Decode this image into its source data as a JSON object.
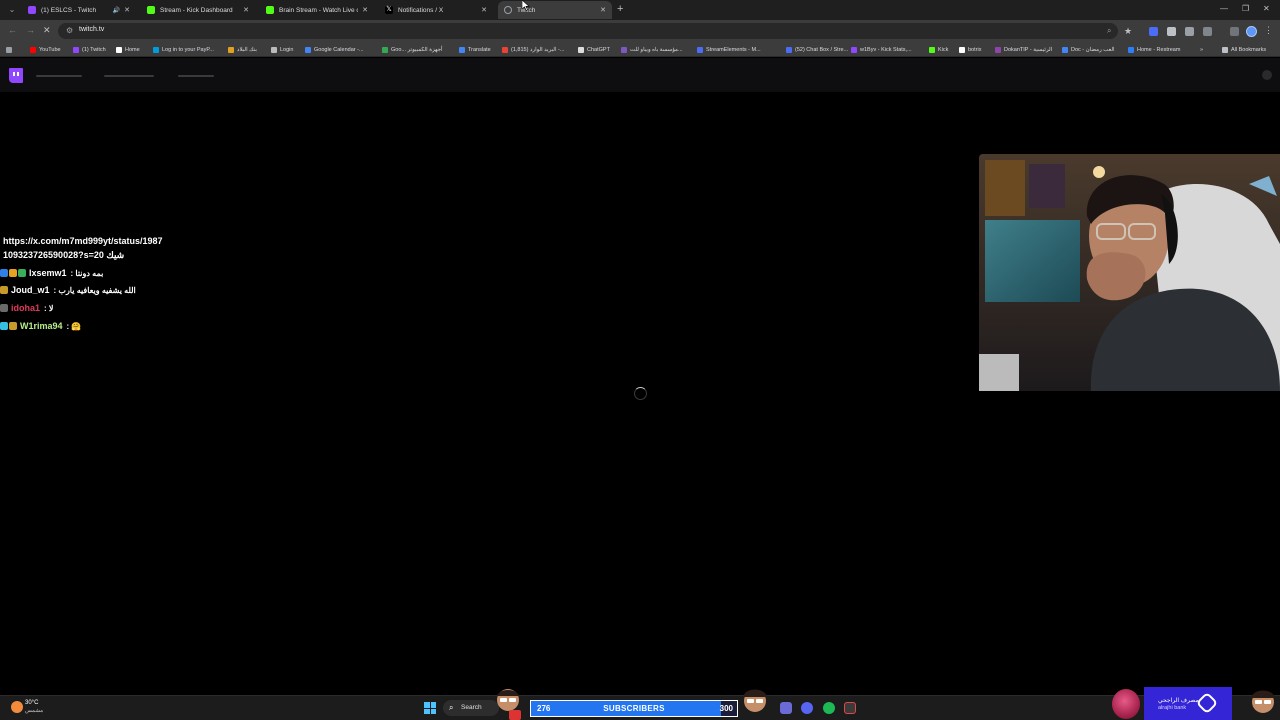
{
  "browser": {
    "tabs": [
      {
        "title": "(1) ESLCS - Twitch",
        "favicon_color": "#9147ff",
        "favicon": "twitch-icon",
        "has_sound": true,
        "active": false
      },
      {
        "title": "Stream - Kick Dashboard",
        "favicon_color": "#53fc18",
        "favicon": "kick-icon",
        "has_sound": false,
        "active": false
      },
      {
        "title": "Brain Stream - Watch Live on K",
        "favicon_color": "#53fc18",
        "favicon": "kick-icon",
        "has_sound": false,
        "active": false
      },
      {
        "title": "Notifications / X",
        "favicon_color": "#000000",
        "favicon": "x-icon",
        "has_sound": false,
        "active": false
      },
      {
        "title": "Twitch",
        "favicon_color": "#9aa0a6",
        "favicon": "loading-icon",
        "has_sound": false,
        "active": true
      }
    ],
    "url": "twitch.tv",
    "bookmarks": [
      {
        "label": "YouTube",
        "color": "#ff0000"
      },
      {
        "label": "(1) Twitch",
        "color": "#9147ff"
      },
      {
        "label": "Home",
        "color": "#ffffff"
      },
      {
        "label": "Log in to your PayP...",
        "color": "#009cde"
      },
      {
        "label": "بنك البلاد",
        "color": "#e0a020"
      },
      {
        "label": "Login",
        "color": "#bbbbbb"
      },
      {
        "label": "Google Calendar -...",
        "color": "#4285f4"
      },
      {
        "label": "Goo... أجهزة الكمبيوتر",
        "color": "#34a853"
      },
      {
        "label": "Translate",
        "color": "#4285f4"
      },
      {
        "label": "(1,815) البريد الوارد -...",
        "color": "#ea4335"
      },
      {
        "label": "ChatGPT",
        "color": "#dddddd"
      },
      {
        "label": "مؤسسة باه ويباو للت...",
        "color": "#7e57c2"
      },
      {
        "label": "StreamElements - M...",
        "color": "#4a6cf7"
      },
      {
        "label": "(52) Chat Box / Stre...",
        "color": "#4a6cf7"
      },
      {
        "label": "w1Byv - Kick Stats,...",
        "color": "#9147ff"
      },
      {
        "label": "Kick",
        "color": "#53fc18"
      },
      {
        "label": "botrix",
        "color": "#ffffff"
      },
      {
        "label": "DokanTIP - الرئيسية",
        "color": "#8e44ad"
      },
      {
        "label": "Doc - العب رمضان",
        "color": "#4285f4"
      },
      {
        "label": "Home - Restream",
        "color": "#2d7ff9"
      }
    ],
    "all_bookmarks_label": "All Bookmarks"
  },
  "overlay": {
    "chat": {
      "link_line1": "https://x.com/m7md999yt/status/1987",
      "link_line2": "109323726590028?s=20 شيك",
      "messages": [
        {
          "user": "lxsemw1",
          "user_color": "#ffffff",
          "text": ": بمه دونتا",
          "badges": [
            "#2f7fe8",
            "#e8a020",
            "#3aaf5a"
          ]
        },
        {
          "user": "Joud_w1",
          "user_color": "#ffffff",
          "text": ": الله يشفيه ويعافيه يارب",
          "badges": [
            "#c89a2a"
          ]
        },
        {
          "user": "idoha1",
          "user_color": "#e03a5a",
          "text": ": لا",
          "badges": [
            "#6a6a6a"
          ]
        },
        {
          "user": "W1rima94",
          "user_color": "#b8f08a",
          "text": ": 🤗",
          "badges": [
            "#35c0e0",
            "#c89a2a"
          ]
        }
      ]
    },
    "sub_goal": {
      "current": "276",
      "label": "SUBSCRIBERS",
      "goal": "300",
      "progress": 0.92
    }
  },
  "taskbar": {
    "weather_temp": "30°C",
    "weather_desc": "مشمس",
    "search_label": "Search",
    "sponsor_ar": "مصرف الراجحي",
    "sponsor_en": "alrajhi bank"
  },
  "colors": {
    "twitch": "#9147ff",
    "kick": "#53fc18",
    "accent": "#2476f0"
  }
}
